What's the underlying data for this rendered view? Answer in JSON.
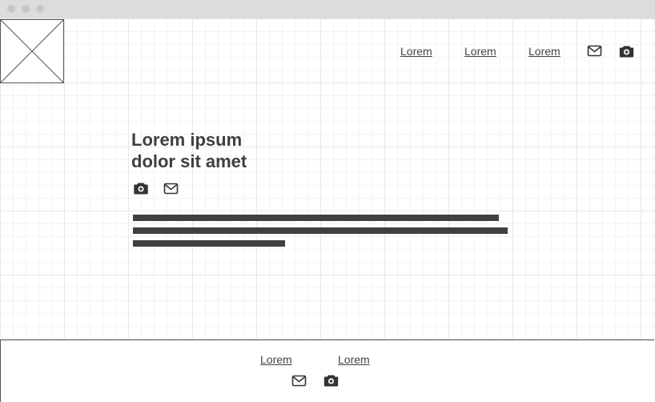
{
  "header": {
    "logo": {
      "icon": "image-placeholder-icon"
    },
    "nav": [
      {
        "label": "Lorem"
      },
      {
        "label": "Lorem"
      },
      {
        "label": "Lorem"
      }
    ],
    "icons": [
      "mail-icon",
      "camera-icon"
    ]
  },
  "hero": {
    "title_line1": "Lorem ipsum",
    "title_line2": "dolor sit amet",
    "icons": [
      "camera-icon",
      "mail-icon"
    ],
    "body_placeholder_lines": 3
  },
  "footer": {
    "links": [
      {
        "label": "Lorem"
      },
      {
        "label": "Lorem"
      }
    ],
    "icons": [
      "mail-icon",
      "camera-icon"
    ]
  },
  "colors": {
    "text": "#444444",
    "heading": "#3f3f3f",
    "bar": "#404040",
    "grid": "#e7e7e7"
  }
}
